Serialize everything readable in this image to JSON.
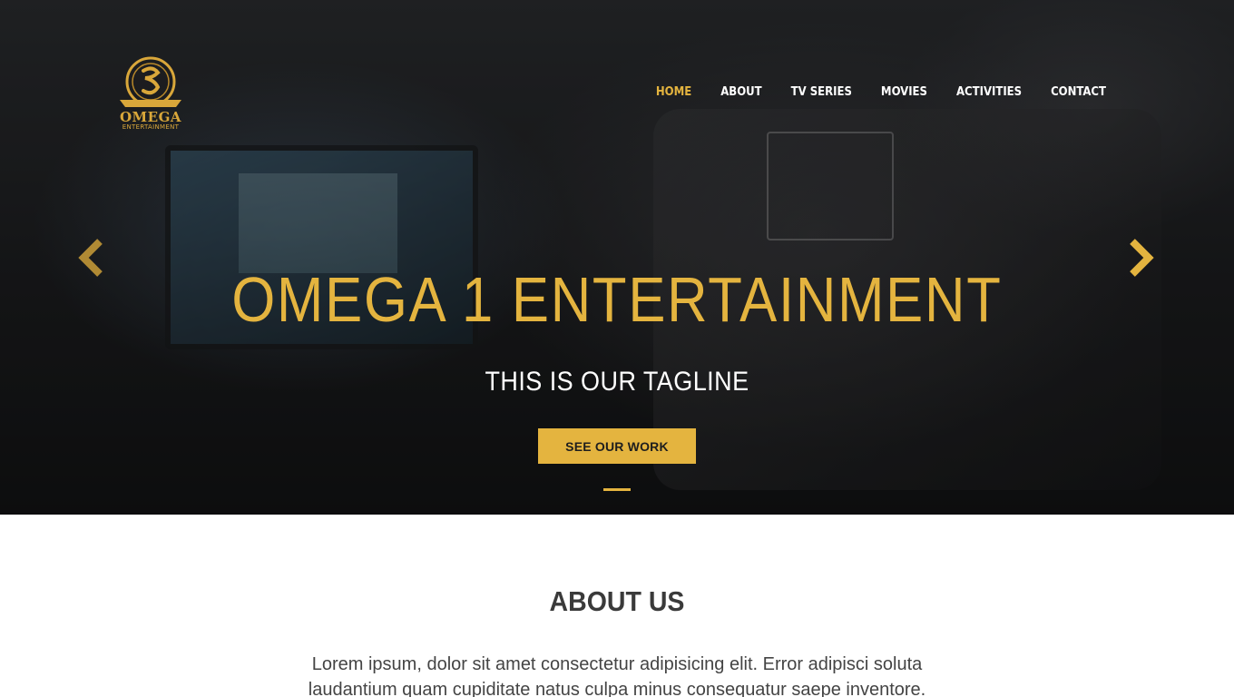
{
  "brand": {
    "logo_text": "OMEGA",
    "logo_subtext": "ENTERTAINMENT"
  },
  "nav": {
    "items": [
      {
        "label": "HOME",
        "active": true
      },
      {
        "label": "ABOUT",
        "active": false
      },
      {
        "label": "TV SERIES",
        "active": false
      },
      {
        "label": "MOVIES",
        "active": false
      },
      {
        "label": "ACTIVITIES",
        "active": false
      },
      {
        "label": "CONTACT",
        "active": false
      }
    ]
  },
  "hero": {
    "title": "OMEGA 1 ENTERTAINMENT",
    "tagline": "THIS IS OUR TAGLINE",
    "button_label": "SEE OUR WORK",
    "prev_icon": "chevron-left-icon",
    "next_icon": "chevron-right-icon"
  },
  "about": {
    "title": "ABOUT US",
    "text": "Lorem ipsum, dolor sit amet consectetur adipisicing elit. Error adipisci soluta laudantium quam cupiditate natus culpa minus consequatur saepe inventore."
  },
  "colors": {
    "accent": "#e4b43f",
    "nav_text": "#ffffff",
    "heading": "#3a3a3a",
    "body_text": "#444444"
  }
}
